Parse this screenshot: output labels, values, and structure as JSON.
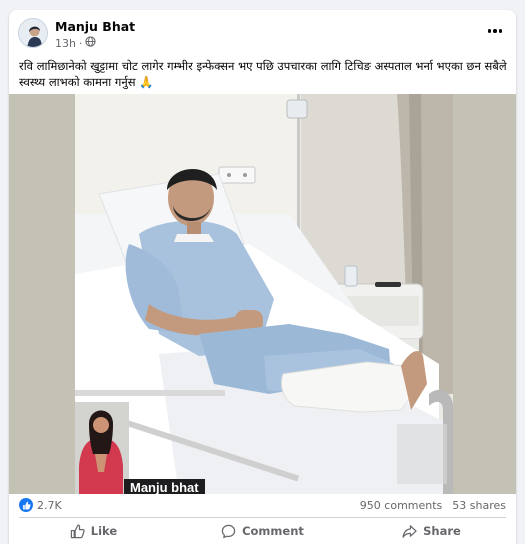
{
  "post": {
    "author": "Manju Bhat",
    "time": "13h",
    "dot": "·",
    "audience_icon": "globe-icon",
    "more_icon": "more-horizontal-icon",
    "caption": "रवि लामिछानेको खुट्टामा चोट लागेर गम्भीर इन्फेक्सन भए पछि उपचारका लागि टिचिङ अस्पताल भर्ना भएका छन सबैले स्वस्थ्य लाभको कामना गर्नुस 🙏",
    "image": {
      "description_icon": "photo-hospital-patient",
      "watermark": "Manju bhat"
    }
  },
  "stats": {
    "reaction_icon": "like-reaction-icon",
    "reactions": "2.7K",
    "comments": "950 comments",
    "shares": "53 shares"
  },
  "actions": [
    {
      "label": "Like",
      "icon": "thumbs-up-icon"
    },
    {
      "label": "Comment",
      "icon": "comment-icon"
    },
    {
      "label": "Share",
      "icon": "share-icon"
    }
  ],
  "colors": {
    "accent": "#1877f2",
    "secondary_text": "#65676b",
    "card": "#ffffff",
    "background": "#f0f2f5"
  }
}
